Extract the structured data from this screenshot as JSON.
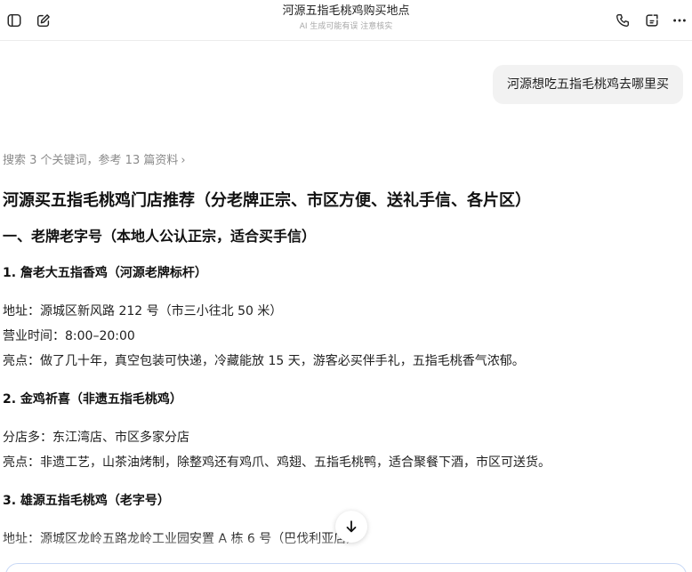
{
  "header": {
    "title": "河源五指毛桃鸡购买地点",
    "subtitle": "AI 生成可能有误 注意核实",
    "icons": {
      "sidebar": "sidebar-toggle-icon",
      "new_chat": "new-chat-icon",
      "call": "phone-icon",
      "share": "share-icon",
      "more": "more-icon"
    }
  },
  "user_message": "河源想吃五指毛桃鸡去哪里买",
  "search_summary": {
    "text": "搜索 3 个关键词，参考 13 篇资料",
    "chevron": "›"
  },
  "answer": {
    "title": "河源买五指毛桃鸡门店推荐（分老牌正宗、市区方便、送礼手信、各片区）",
    "section1_heading": "一、老牌老字号（本地人公认正宗，适合买手信）",
    "items": [
      {
        "heading": "1. 詹老大五指香鸡（河源老牌标杆）",
        "lines": [
          "地址：源城区新风路 212 号（市三小往北 50 米）",
          "营业时间：8:00–20:00",
          "亮点：做了几十年，真空包装可快递，冷藏能放 15 天，游客必买伴手礼，五指毛桃香气浓郁。"
        ]
      },
      {
        "heading": "2. 金鸡祈喜（非遗五指毛桃鸡）",
        "lines": [
          "分店多：东江湾店、市区多家分店",
          "亮点：非遗工艺，山茶油烤制，除整鸡还有鸡爪、鸡翅、五指毛桃鸭，适合聚餐下酒，市区可送货。"
        ]
      },
      {
        "heading": "3. 雄源五指毛桃鸡（老字号）",
        "lines": [
          "地址：源城区龙岭五路龙岭工业园安置 A 栋 6 号（巴伐利亚店）"
        ]
      }
    ]
  }
}
